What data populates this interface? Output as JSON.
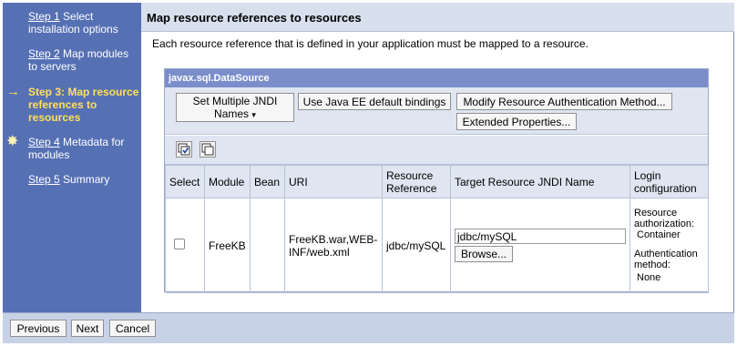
{
  "sidebar": {
    "steps": [
      {
        "link": "Step 1",
        "text": " Select installation options"
      },
      {
        "link": "Step 2",
        "text": " Map modules to servers"
      },
      {
        "current_text": "Step 3: Map resource references to resources",
        "marker_icon": "arrow-right-icon"
      },
      {
        "link": "Step 4",
        "text": " Metadata for modules",
        "marker_icon": "star-icon"
      },
      {
        "link": "Step 5",
        "text": " Summary"
      }
    ]
  },
  "main": {
    "title": "Map resource references to resources",
    "description": "Each resource reference that is defined in your application must be mapped to a resource."
  },
  "datasource": {
    "header": "javax.sql.DataSource",
    "buttons": {
      "set_multiple_line1": "Set Multiple JNDI",
      "set_multiple_line2": "Names",
      "set_multiple_caret": "▾",
      "default_bindings": "Use Java EE default bindings",
      "modify_auth": "Modify Resource Authentication Method...",
      "extended_props": "Extended Properties..."
    },
    "icons": [
      "select-all-icon",
      "deselect-all-icon"
    ]
  },
  "table": {
    "headers": {
      "select": "Select",
      "module": "Module",
      "bean": "Bean",
      "uri": "URI",
      "resource_reference": "Resource Reference",
      "target": "Target Resource JNDI Name",
      "login": "Login configuration"
    },
    "rows": [
      {
        "module": "FreeKB",
        "bean": "",
        "uri": "FreeKB.war,WEB-INF/web.xml",
        "resource_reference": "jdbc/mySQL",
        "target_value": "jdbc/mySQL",
        "browse": "Browse...",
        "login": {
          "auth_label": "Resource authorization:",
          "auth_value": "Container",
          "method_label": "Authentication method:",
          "method_value": "None"
        }
      }
    ]
  },
  "footer": {
    "previous": "Previous",
    "next": "Next",
    "cancel": "Cancel"
  }
}
